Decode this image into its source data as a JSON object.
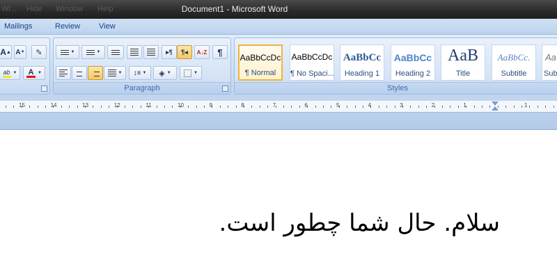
{
  "window": {
    "title": "Document1 - Microsoft Word",
    "ghost_menu": [
      "Wi...",
      "Hide",
      "Window",
      "Help"
    ]
  },
  "tabs": [
    "Mailings",
    "Review",
    "View"
  ],
  "ribbon": {
    "groups": {
      "paragraph": "Paragraph",
      "styles": "Styles"
    },
    "font_buttons": {
      "grow": "A",
      "shrink": "A",
      "highlight": "ab",
      "font_color": "A"
    },
    "paragraph_buttons": {
      "ltr": "▸¶",
      "rtl": "¶◂",
      "sort": "A↓Z",
      "show_marks": "¶"
    },
    "styles": [
      {
        "sample": "AaBbCcDc",
        "name": "¶ Normal",
        "selected": true
      },
      {
        "sample": "AaBbCcDc",
        "name": "¶ No Spaci...",
        "selected": false
      },
      {
        "sample": "AaBbCc",
        "name": "Heading 1",
        "selected": false
      },
      {
        "sample": "AaBbCc",
        "name": "Heading 2",
        "selected": false
      },
      {
        "sample": "AaB",
        "name": "Title",
        "selected": false
      },
      {
        "sample": "AaBbCc.",
        "name": "Subtitle",
        "selected": false
      },
      {
        "sample": "Aa",
        "name": "Subt",
        "selected": false
      }
    ]
  },
  "ruler": {
    "numbers": [
      "15",
      "14",
      "13",
      "12",
      "11",
      "10",
      "9",
      "8",
      "7",
      "6",
      "5",
      "4",
      "3",
      "2",
      "1",
      "1"
    ]
  },
  "document": {
    "text": "سلام. حال شما چطور است."
  },
  "colors": {
    "accent": "#15428b",
    "selected_style_border": "#f0b43f",
    "font_color_bar": "#e81010",
    "highlight_bar": "#f2e51a"
  }
}
